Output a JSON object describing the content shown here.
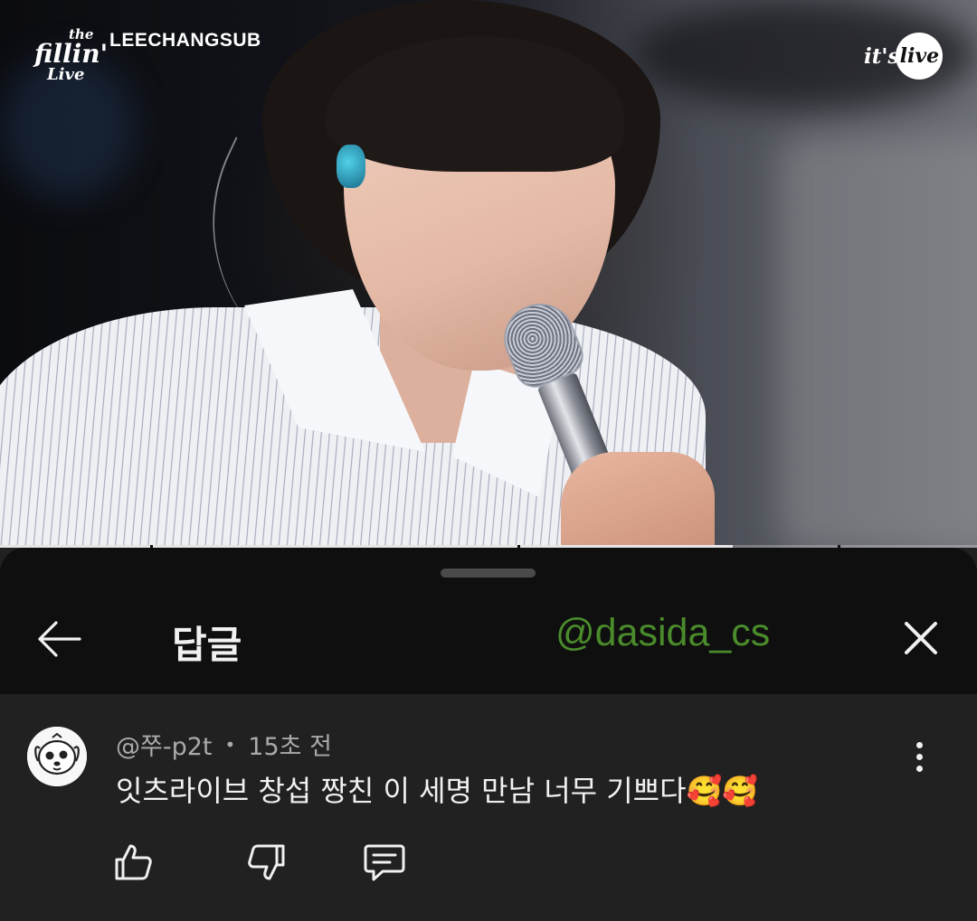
{
  "video": {
    "logo_line1": "the",
    "logo_line2": "fillin'",
    "logo_line3": "Live",
    "channel_name": "LEECHANGSUB",
    "badge_prefix": "it's",
    "badge_circle": "live",
    "progress_fraction": 0.75
  },
  "sheet": {
    "title": "답글",
    "watermark": "@dasida_cs",
    "back_icon": "arrow-left-icon",
    "close_icon": "close-icon"
  },
  "reply": {
    "author": "@쭈-p2t",
    "separator": "•",
    "time": "15초 전",
    "text": "잇츠라이브 창섭 짱친 이 세명 만남 너무 기쁘다🥰🥰",
    "avatar_icon": "dog-avatar-icon",
    "actions": [
      "thumbs-up-icon",
      "thumbs-down-icon",
      "reply-icon"
    ],
    "menu_icon": "more-vertical-icon"
  }
}
